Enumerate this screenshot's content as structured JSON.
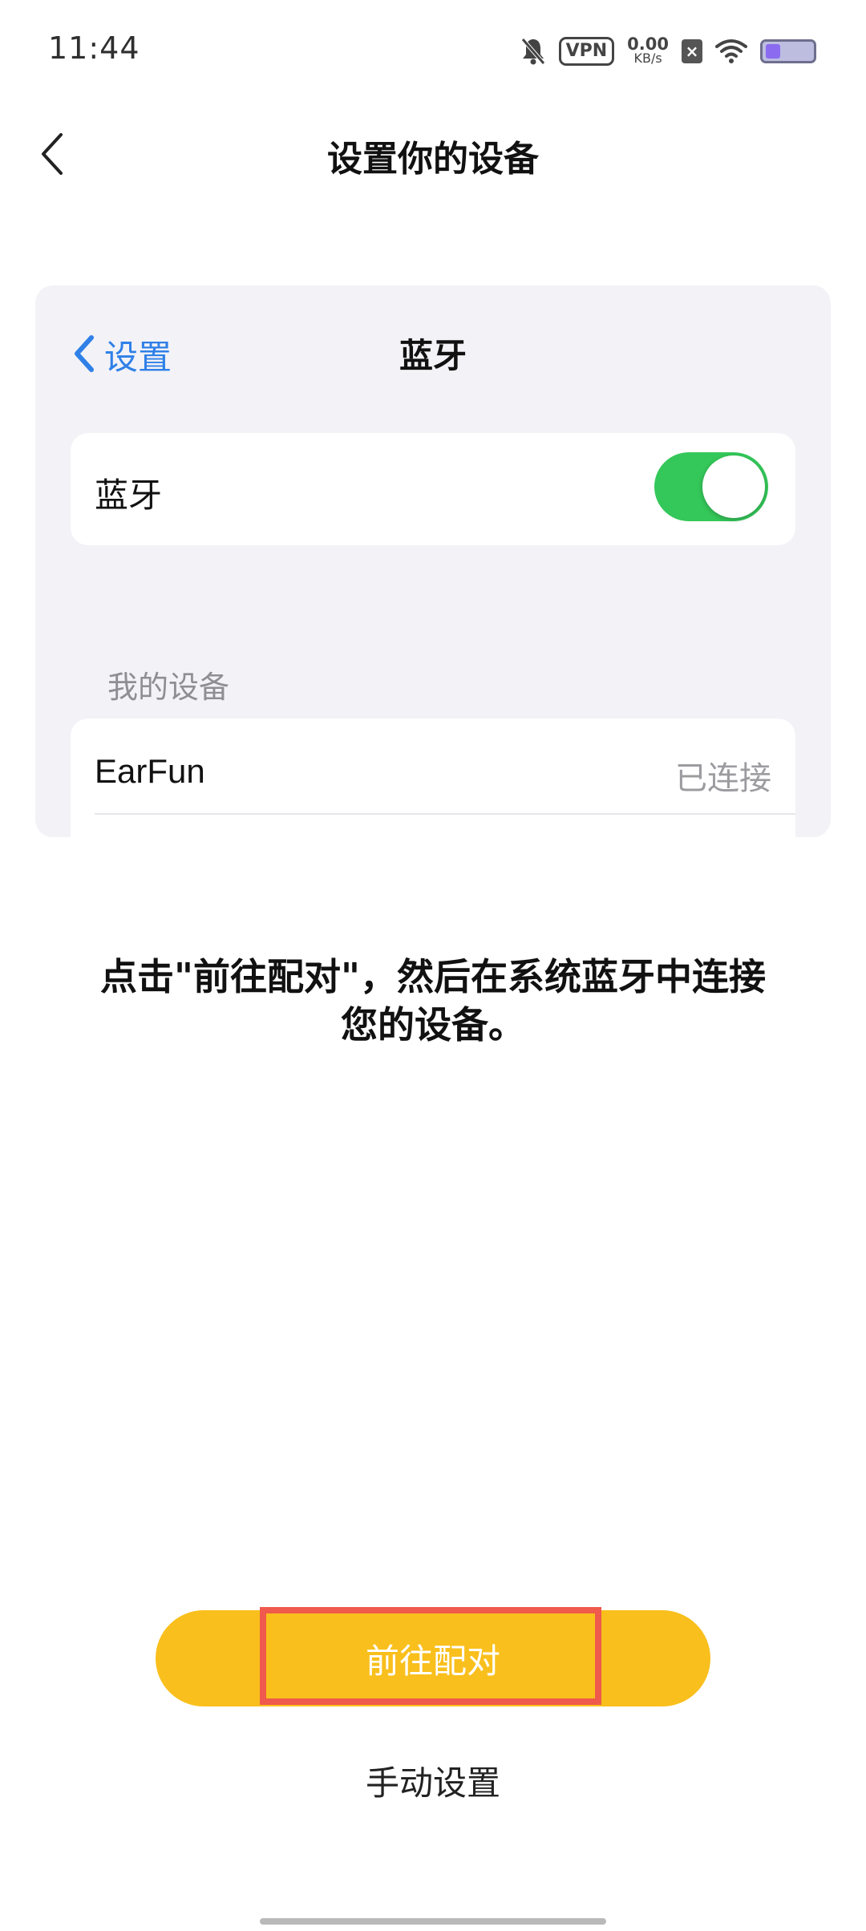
{
  "status_bar": {
    "time": "11:44",
    "vpn_label": "VPN",
    "net_speed_value": "0.00",
    "net_speed_unit": "KB/s",
    "sim_label": "×",
    "icons": [
      "bell-muted-icon",
      "vpn-icon",
      "net-speed",
      "sim-x-icon",
      "wifi-icon",
      "battery-icon"
    ]
  },
  "header": {
    "title": "设置你的设备",
    "back_icon": "chevron-left-icon"
  },
  "illustration": {
    "nav_back_label": "设置",
    "nav_title": "蓝牙",
    "bluetooth_row_label": "蓝牙",
    "bluetooth_enabled": true,
    "section_header": "我的设备",
    "devices": [
      {
        "name": "EarFun",
        "status": "已连接"
      }
    ],
    "colors": {
      "accent_blue": "#2f80e7",
      "toggle_green": "#34c759",
      "card_background": "#f2f2f7"
    }
  },
  "instruction": {
    "line1": "点击\"前往配对\"，然后在系统蓝牙中连接",
    "line2": "您的设备。"
  },
  "actions": {
    "pair_label": "前往配对",
    "manual_label": "手动设置",
    "primary_color": "#f9bf1c",
    "highlight_color": "#ef5a4c"
  }
}
